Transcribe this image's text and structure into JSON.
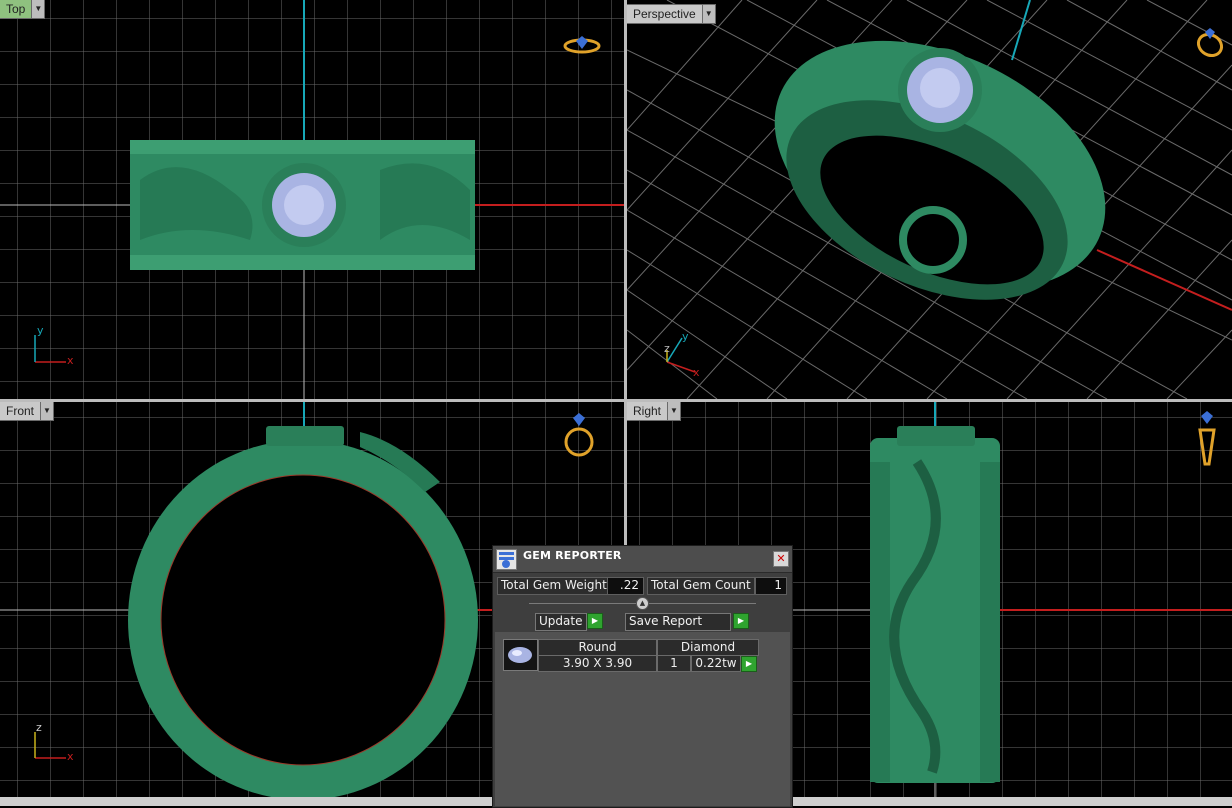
{
  "viewports": {
    "top": {
      "label": "Top"
    },
    "perspective": {
      "label": "Perspective"
    },
    "front": {
      "label": "Front"
    },
    "right": {
      "label": "Right"
    }
  },
  "axes": {
    "x": "x",
    "y": "y",
    "z": "z"
  },
  "colors": {
    "grid": "#5f5f5f",
    "ring": "#2e8a62",
    "gem": "#a9b4e3",
    "axis_red": "#c41e1e",
    "axis_cyan": "#17a8b8",
    "top_label_bg": "#8fc17f"
  },
  "gem_reporter": {
    "title": "GEM REPORTER",
    "total_gem_weight_label": "Total Gem Weight",
    "total_gem_weight": ".22",
    "total_gem_count_label": "Total Gem Count",
    "total_gem_count": "1",
    "update_label": "Update",
    "save_report_label": "Save Report",
    "gem": {
      "shape": "Round",
      "material": "Diamond",
      "size": "3.90 X 3.90",
      "count": "1",
      "weight": "0.22tw"
    }
  }
}
